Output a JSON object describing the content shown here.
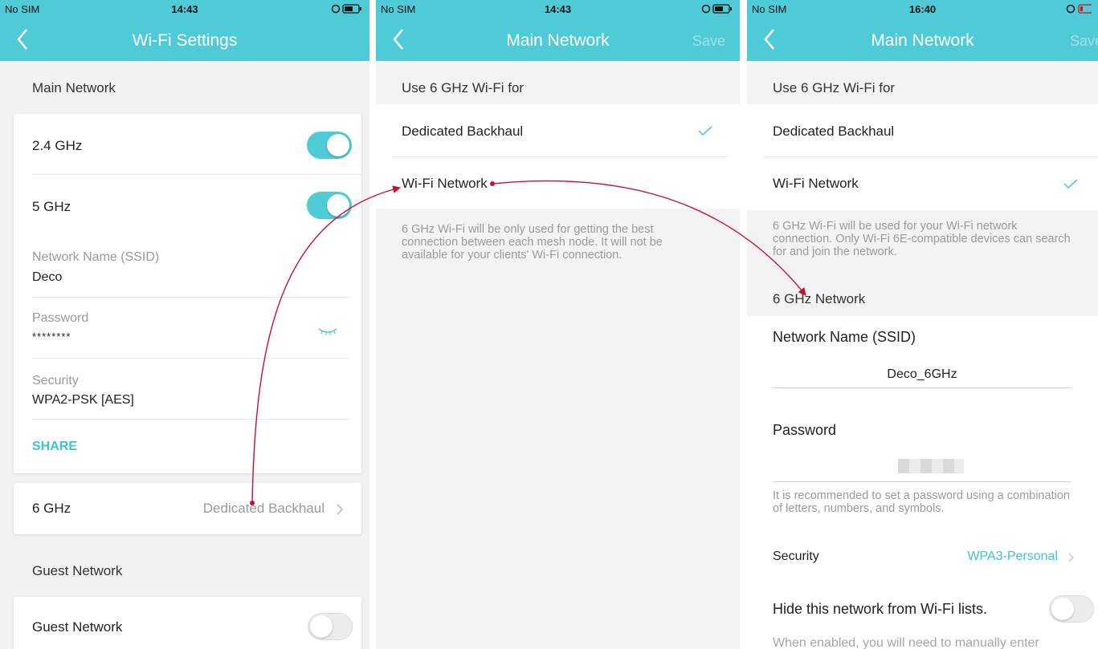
{
  "colors": {
    "accent": "#4fcad7",
    "teal_text": "#3cc3d2",
    "arrow": "#c8102e"
  },
  "screen1": {
    "status": {
      "carrier": "No SIM",
      "time": "14:43"
    },
    "title": "Wi-Fi Settings",
    "main_section": "Main Network",
    "band_24": {
      "label": "2.4 GHz",
      "enabled": true
    },
    "band_5": {
      "label": "5 GHz",
      "enabled": true
    },
    "ssid": {
      "label": "Network Name (SSID)",
      "value": "Deco"
    },
    "password": {
      "label": "Password",
      "value": "********"
    },
    "security": {
      "label": "Security",
      "value": "WPA2-PSK [AES]"
    },
    "share_label": "SHARE",
    "band_6": {
      "label": "6 GHz",
      "value": "Dedicated Backhaul"
    },
    "guest_section": "Guest Network",
    "guest_row": {
      "label": "Guest Network",
      "enabled": false
    }
  },
  "screen2": {
    "status": {
      "carrier": "No SIM",
      "time": "14:43"
    },
    "title": "Main Network",
    "save_label": "Save",
    "section": "Use 6 GHz Wi-Fi for",
    "options": [
      "Dedicated Backhaul",
      "Wi-Fi Network"
    ],
    "selected": "Dedicated Backhaul",
    "description": "6 GHz Wi-Fi will be only used for getting the best connection between each mesh node. It will not be available for your clients' Wi-Fi connection."
  },
  "screen3": {
    "status": {
      "carrier": "No SIM",
      "time": "16:40"
    },
    "title": "Main Network",
    "save_label": "Save",
    "section": "Use 6 GHz Wi-Fi for",
    "options": [
      "Dedicated Backhaul",
      "Wi-Fi Network"
    ],
    "selected": "Wi-Fi Network",
    "description": "6 GHz Wi-Fi will be used for your Wi-Fi network connection. Only Wi-Fi 6E-compatible devices can search for and join the network.",
    "network_section": "6 GHz Network",
    "ssid_label": "Network Name (SSID)",
    "ssid_value": "Deco_6GHz",
    "password_label": "Password",
    "password_hint": "It is recommended to set a password using a combination of letters, numbers, and symbols.",
    "security_label": "Security",
    "security_value": "WPA3-Personal",
    "hide_label": "Hide this network from Wi-Fi lists.",
    "hide_enabled": false,
    "hide_note": "When enabled, you will need to manually enter"
  }
}
